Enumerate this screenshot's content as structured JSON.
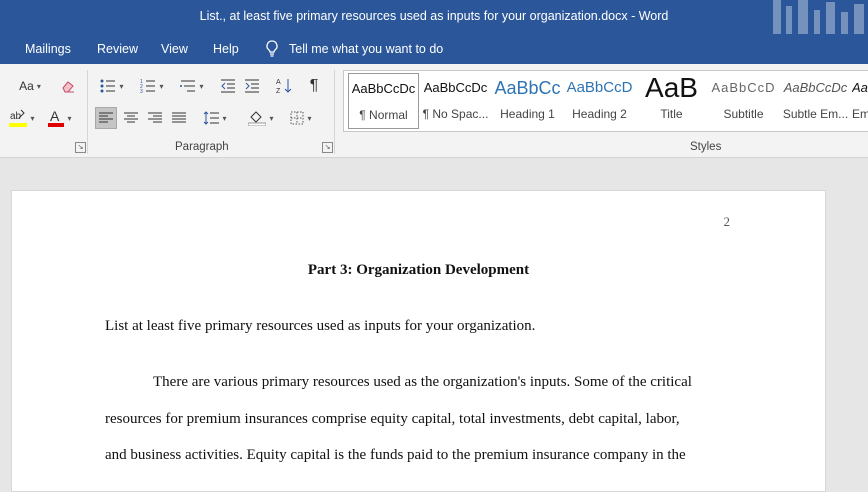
{
  "window": {
    "title": "List., at least five primary resources used as inputs for your organization.docx  -  Word"
  },
  "menu": {
    "items": [
      "Mailings",
      "Review",
      "View",
      "Help"
    ],
    "tell_me": "Tell me what you want to do"
  },
  "ribbon": {
    "font_size_label": "Aa",
    "groups": {
      "paragraph": "Paragraph",
      "styles": "Styles"
    },
    "styles": [
      {
        "preview": "AaBbCcDc",
        "name": "¶ Normal"
      },
      {
        "preview": "AaBbCcDc",
        "name": "¶ No Spac..."
      },
      {
        "preview": "AaBbCc",
        "name": "Heading 1"
      },
      {
        "preview": "AaBbCcD",
        "name": "Heading 2"
      },
      {
        "preview": "AaB",
        "name": "Title"
      },
      {
        "preview": "AaBbCcD",
        "name": "Subtitle"
      },
      {
        "preview": "AaBbCcDc",
        "name": "Subtle Em..."
      },
      {
        "preview": "AaBbCcDc",
        "name": "Em"
      }
    ]
  },
  "document": {
    "page_number": "2",
    "heading": "Part 3: Organization Development",
    "question": "List at least five primary resources used as inputs for your organization.",
    "lines": [
      "There are various primary resources used as the organization's inputs. Some of the critical",
      "resources for premium insurances comprise equity capital, total investments, debt capital, labor,",
      "and business activities. Equity capital is the funds paid to the premium insurance company in the"
    ]
  },
  "colors": {
    "accent": "#2b579a",
    "heading_blue": "#2e74b5",
    "highlight_yellow": "#ffff00",
    "font_red": "#e00000"
  }
}
